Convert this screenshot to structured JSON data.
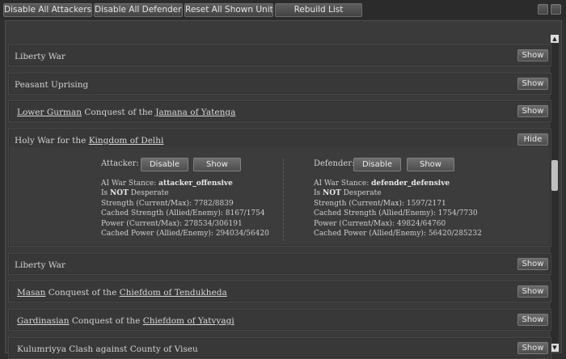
{
  "toolbar": {
    "disable_all_attackers": "Disable All Attackers",
    "disable_all_defenders": "Disable All Defenders",
    "reset_all_shown": "Reset All Shown Units",
    "rebuild_list": "Rebuild List"
  },
  "rows": [
    {
      "pre": "Liberty War",
      "link1": "",
      "mid": "",
      "link2": "",
      "button": "Show"
    },
    {
      "pre": "Peasant Uprising",
      "link1": "",
      "mid": "",
      "link2": "",
      "button": "Show"
    },
    {
      "pre": "",
      "link1": "Lower Gurman",
      "mid": " Conquest of the ",
      "link2": "Jamana of Yatenga",
      "button": "Show"
    },
    {
      "pre": "Holy War for the ",
      "link1": "Kingdom of Delhi",
      "mid": "",
      "link2": "",
      "button": "Hide"
    },
    {
      "pre": "Liberty War",
      "link1": "",
      "mid": "",
      "link2": "",
      "button": "Show"
    },
    {
      "pre": "",
      "link1": "Masan",
      "mid": " Conquest of the ",
      "link2": "Chiefdom of Tendukheda",
      "button": "Show"
    },
    {
      "pre": "",
      "link1": "Gardinasian",
      "mid": " Conquest of the ",
      "link2": "Chiefdom of Yatvyagi",
      "button": "Show"
    },
    {
      "pre": "Kulumriyya Clash against County of Viseu",
      "link1": "",
      "mid": "",
      "link2": "",
      "button": "Show"
    }
  ],
  "expanded": {
    "attacker": {
      "label": "Attacker:",
      "disable": "Disable",
      "show": "Show",
      "stance_label": "AI War Stance: ",
      "stance_value": "attacker_offensive",
      "desperate_pre": "Is ",
      "desperate_not": "NOT",
      "desperate_post": " Desperate",
      "strength": "Strength (Current/Max): 7782/8839",
      "cached_strength": "Cached Strength (Allied/Enemy): 8167/1754",
      "power": "Power (Current/Max): 278534/306191",
      "cached_power": "Cached Power (Allied/Enemy): 294034/56420"
    },
    "defender": {
      "label": "Defender:",
      "disable": "Disable",
      "show": "Show",
      "stance_label": "AI War Stance: ",
      "stance_value": "defender_defensive",
      "desperate_pre": "Is ",
      "desperate_not": "NOT",
      "desperate_post": " Desperate",
      "strength": "Strength (Current/Max): 1597/2171",
      "cached_strength": "Cached Strength (Allied/Enemy): 1754/7730",
      "power": "Power (Current/Max): 49824/64760",
      "cached_power": "Cached Power (Allied/Enemy): 56420/285232"
    }
  },
  "icons": {
    "scroll_up": "▲",
    "scroll_down": "▼"
  }
}
